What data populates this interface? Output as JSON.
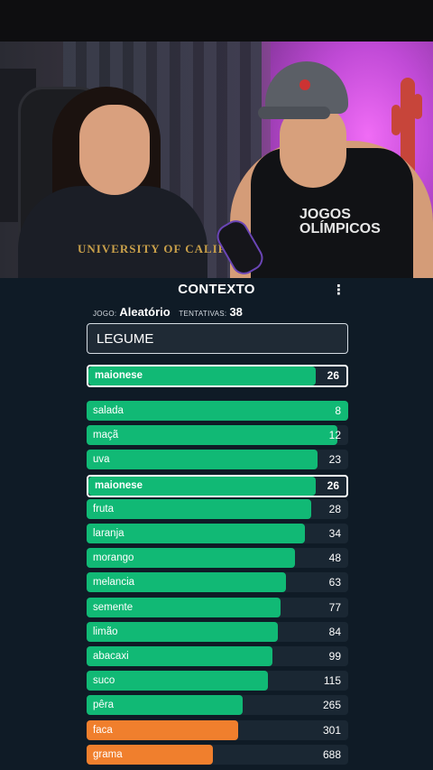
{
  "colors": {
    "green": "#11b975",
    "orange": "#f07f2d",
    "bar_bg": "#1a2733",
    "panel_bg": "#0f1b26"
  },
  "webcam": {
    "shirt_left_text": "UNIVERSITY OF CALIFORNIA",
    "shirt_right_text": "JOGOS OLÍMPICOS"
  },
  "game": {
    "title": "CONTEXTO",
    "menu_icon": "⋮",
    "jogo_label": "JOGO:",
    "jogo_value": "Aleatório",
    "tentativas_label": "TENTATIVAS:",
    "tentativas_value": "38",
    "input_value": "LEGUME",
    "last_guess": {
      "word": "maionese",
      "rank": 26,
      "color": "green"
    },
    "guesses": [
      {
        "word": "salada",
        "rank": 8,
        "color": "green"
      },
      {
        "word": "maçã",
        "rank": 12,
        "color": "green"
      },
      {
        "word": "uva",
        "rank": 23,
        "color": "green"
      },
      {
        "word": "maionese",
        "rank": 26,
        "color": "green",
        "highlight": true
      },
      {
        "word": "fruta",
        "rank": 28,
        "color": "green"
      },
      {
        "word": "laranja",
        "rank": 34,
        "color": "green"
      },
      {
        "word": "morango",
        "rank": 48,
        "color": "green"
      },
      {
        "word": "melancia",
        "rank": 63,
        "color": "green"
      },
      {
        "word": "semente",
        "rank": 77,
        "color": "green"
      },
      {
        "word": "limão",
        "rank": 84,
        "color": "green"
      },
      {
        "word": "abacaxi",
        "rank": 99,
        "color": "green"
      },
      {
        "word": "suco",
        "rank": 115,
        "color": "green"
      },
      {
        "word": "pêra",
        "rank": 265,
        "color": "green"
      },
      {
        "word": "faca",
        "rank": 301,
        "color": "orange"
      },
      {
        "word": "grama",
        "rank": 688,
        "color": "orange"
      }
    ]
  }
}
